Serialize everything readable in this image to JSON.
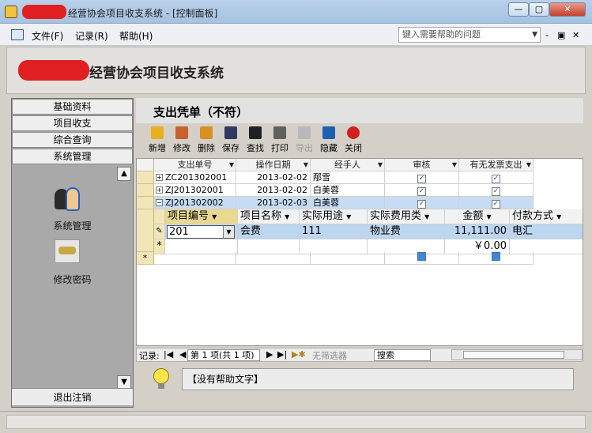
{
  "window": {
    "title": "经营协会项目收支系统 - [控制面板]",
    "min_glyph": "—",
    "max_glyph": "▢",
    "close_glyph": "✕"
  },
  "menu": {
    "items": [
      "文件(F)",
      "记录(R)",
      "帮助(H)"
    ],
    "help_placeholder": "键入需要帮助的问题",
    "mdi_min": "-",
    "mdi_restore": "▣",
    "mdi_close": "✕"
  },
  "header": {
    "title": "经营协会项目收支系统"
  },
  "nav": {
    "tabs": [
      "基础资料",
      "项目收支",
      "综合查询",
      "系统管理"
    ],
    "items": [
      {
        "label": "系统管理",
        "icon": "users-icon"
      },
      {
        "label": "修改密码",
        "icon": "key-icon"
      }
    ],
    "scroll_up": "▲",
    "scroll_down": "▼",
    "logout": "退出注销"
  },
  "form": {
    "title": "支出凭单（不符）",
    "toolbar": [
      {
        "label": "新增",
        "icon": "new-icon",
        "color": "#e8b020",
        "enabled": true
      },
      {
        "label": "修改",
        "icon": "edit-icon",
        "color": "#c86030",
        "enabled": true
      },
      {
        "label": "删除",
        "icon": "delete-icon",
        "color": "#d89020",
        "enabled": true
      },
      {
        "label": "保存",
        "icon": "save-icon",
        "color": "#303a60",
        "enabled": true
      },
      {
        "label": "查找",
        "icon": "find-icon",
        "color": "#202020",
        "enabled": true
      },
      {
        "label": "打印",
        "icon": "print-icon",
        "color": "#606060",
        "enabled": true
      },
      {
        "label": "导出",
        "icon": "export-icon",
        "color": "#b8b8b8",
        "enabled": false
      },
      {
        "label": "隐藏",
        "icon": "hide-icon",
        "color": "#2060b0",
        "enabled": true
      },
      {
        "label": "关闭",
        "icon": "close-icon",
        "color": "#d02020",
        "enabled": true
      }
    ]
  },
  "grid": {
    "columns": [
      "支出单号",
      "操作日期",
      "经手人",
      "审核",
      "有无发票支出"
    ],
    "rows": [
      {
        "no": "ZC201302001",
        "date": "2013-02-02",
        "handler": "邴雪",
        "audited": true,
        "invoice": true
      },
      {
        "no": "ZJ201302001",
        "date": "2013-02-02",
        "handler": "白美蓉",
        "audited": true,
        "invoice": true
      },
      {
        "no": "ZJ201302002",
        "date": "2013-02-03",
        "handler": "白美蓉",
        "audited": true,
        "invoice": true
      }
    ],
    "subgrid": {
      "columns": [
        "项目编号",
        "项目名称",
        "实际用途",
        "实际费用类",
        "金额",
        "付款方式"
      ],
      "rows": [
        {
          "code": "201",
          "name": "会费",
          "usage": "111",
          "type": "物业费",
          "amount": "11,111.00",
          "pay": "电汇"
        }
      ],
      "new_row_amount": "￥0.00"
    },
    "new_row_marker": "*",
    "current_marker": "▶",
    "pencil_marker": "✎"
  },
  "recordbar": {
    "label": "记录:",
    "first": "|◀",
    "prev": "◀",
    "position": "第 1 项(共 1 项)",
    "next": "▶",
    "last": "▶|",
    "new": "▶✱",
    "filter": "无筛选器",
    "search": "搜索"
  },
  "help": {
    "text": "【没有帮助文字】"
  }
}
